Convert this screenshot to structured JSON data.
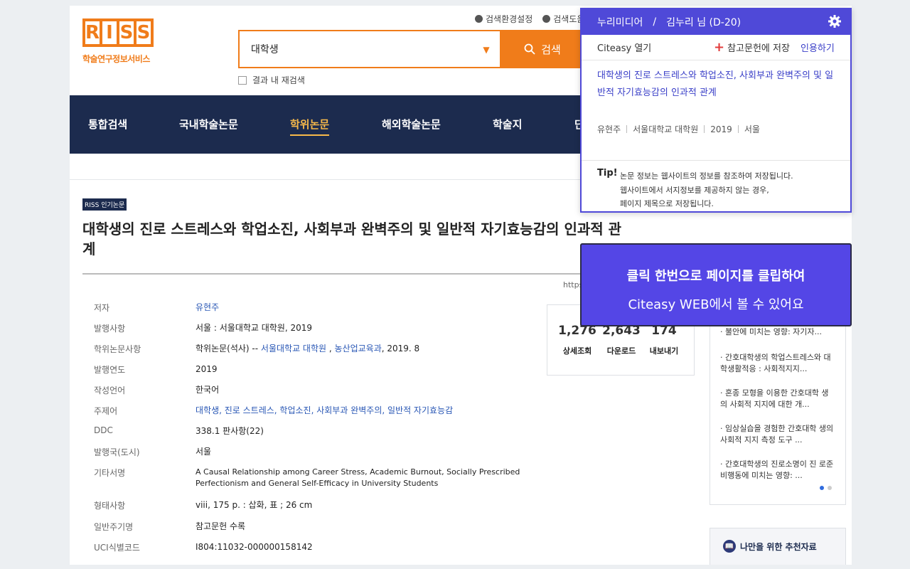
{
  "header": {
    "logo_letters": [
      "R",
      "I",
      "S",
      "S"
    ],
    "logo_sub": "학술연구정보서비스",
    "top_links": [
      "검색환경설정",
      "검색도움"
    ],
    "search": {
      "value": "대학생",
      "button": "검색"
    },
    "recheck_label": "결과 내 재검색"
  },
  "nav": {
    "items": [
      "통합검색",
      "국내학술논문",
      "학위논문",
      "해외학술논문",
      "학술지",
      "단"
    ],
    "active_index": 2
  },
  "doc": {
    "badge": "RISS 인기논문",
    "title": "대학생의 진로 스트레스와 학업소진, 사회부과 완벽주의 및 일반적 자기효능감의 인과적 관계",
    "url_frag": "https",
    "details": [
      {
        "k": "저자",
        "v": "유현주"
      },
      {
        "k": "발행사항",
        "v": "서울 : 서울대학교 대학원, 2019"
      },
      {
        "k": "학위논문사항",
        "v_prefix": "학위논문(석사) -- ",
        "v_links": [
          "서울대학교 대학원",
          "농산업교육과"
        ],
        "v_suffix": ", 2019. 8"
      },
      {
        "k": "발행연도",
        "v": "2019"
      },
      {
        "k": "작성언어",
        "v": "한국어"
      },
      {
        "k": "주제어",
        "v": "대학생, 진로 스트레스, 학업소진, 사회부과 완벽주의, 일반적 자기효능감"
      },
      {
        "k": "DDC",
        "v": "338.1 판사항(22)"
      },
      {
        "k": "발행국(도시)",
        "v": "서울"
      },
      {
        "k": "기타서명",
        "v": "A Causal Relationship among Career Stress, Academic Burnout, Socially Prescribed Perfectionism and General Self-Efficacy in University Students"
      },
      {
        "k": "형태사항",
        "v": "viii, 175 p. : 삽화, 표 ; 26 cm"
      },
      {
        "k": "일반주기명",
        "v": "참고문헌 수록"
      },
      {
        "k": "UCI식별코드",
        "v": "I804:11032-000000158142"
      }
    ]
  },
  "stats": [
    {
      "n": "1,276",
      "l": "상세조회"
    },
    {
      "n": "2,643",
      "l": "다운로드"
    },
    {
      "n": "174",
      "l": "내보내기"
    }
  ],
  "sidebar": {
    "items": [
      "불안에 미치는 영향: 자기자...",
      "간호대학생의 학업스트레스와 대학생활적응 : 사회적지지...",
      "혼종 모형을 이용한 간호대학 생의 사회적 지지에 대한 개...",
      "임상실습을 경험한 간호대학 생의 사회적 지지 측정 도구 ...",
      "간호대학생의 진로소명이 진 로준비행동에 미치는 영향: ..."
    ],
    "rec_label": "나만을 위한 추천자료"
  },
  "popup": {
    "org": "누리미디어",
    "slash": "/",
    "user": "김누리 님 (D-20)",
    "open": "Citeasy 열기",
    "save": "참고문헌에 저장",
    "cite": "인용하기",
    "title": "대학생의 진로 스트레스와 학업소진, 사회부과 완벽주의 및 일반적 자기효능감의 인과적 관계",
    "meta": [
      "유현주",
      "서울대학교 대학원",
      "2019",
      "서울"
    ],
    "tip_label": "Tip!",
    "tip_lines": [
      "논문 정보는 웹사이트의 정보를 참조하여 저장됩니다.",
      "웹사이트에서 서지정보를 제공하지 않는 경우,",
      "페이지 제목으로 저장됩니다."
    ]
  },
  "banner": {
    "line1": "클릭 한번으로 페이지를 클립하여",
    "line2": "Citeasy WEB에서 볼 수 있어요"
  },
  "colors": {
    "accent": "#f07c1a",
    "nav_bg": "#1c2b4e",
    "popup": "#4f49d8"
  }
}
